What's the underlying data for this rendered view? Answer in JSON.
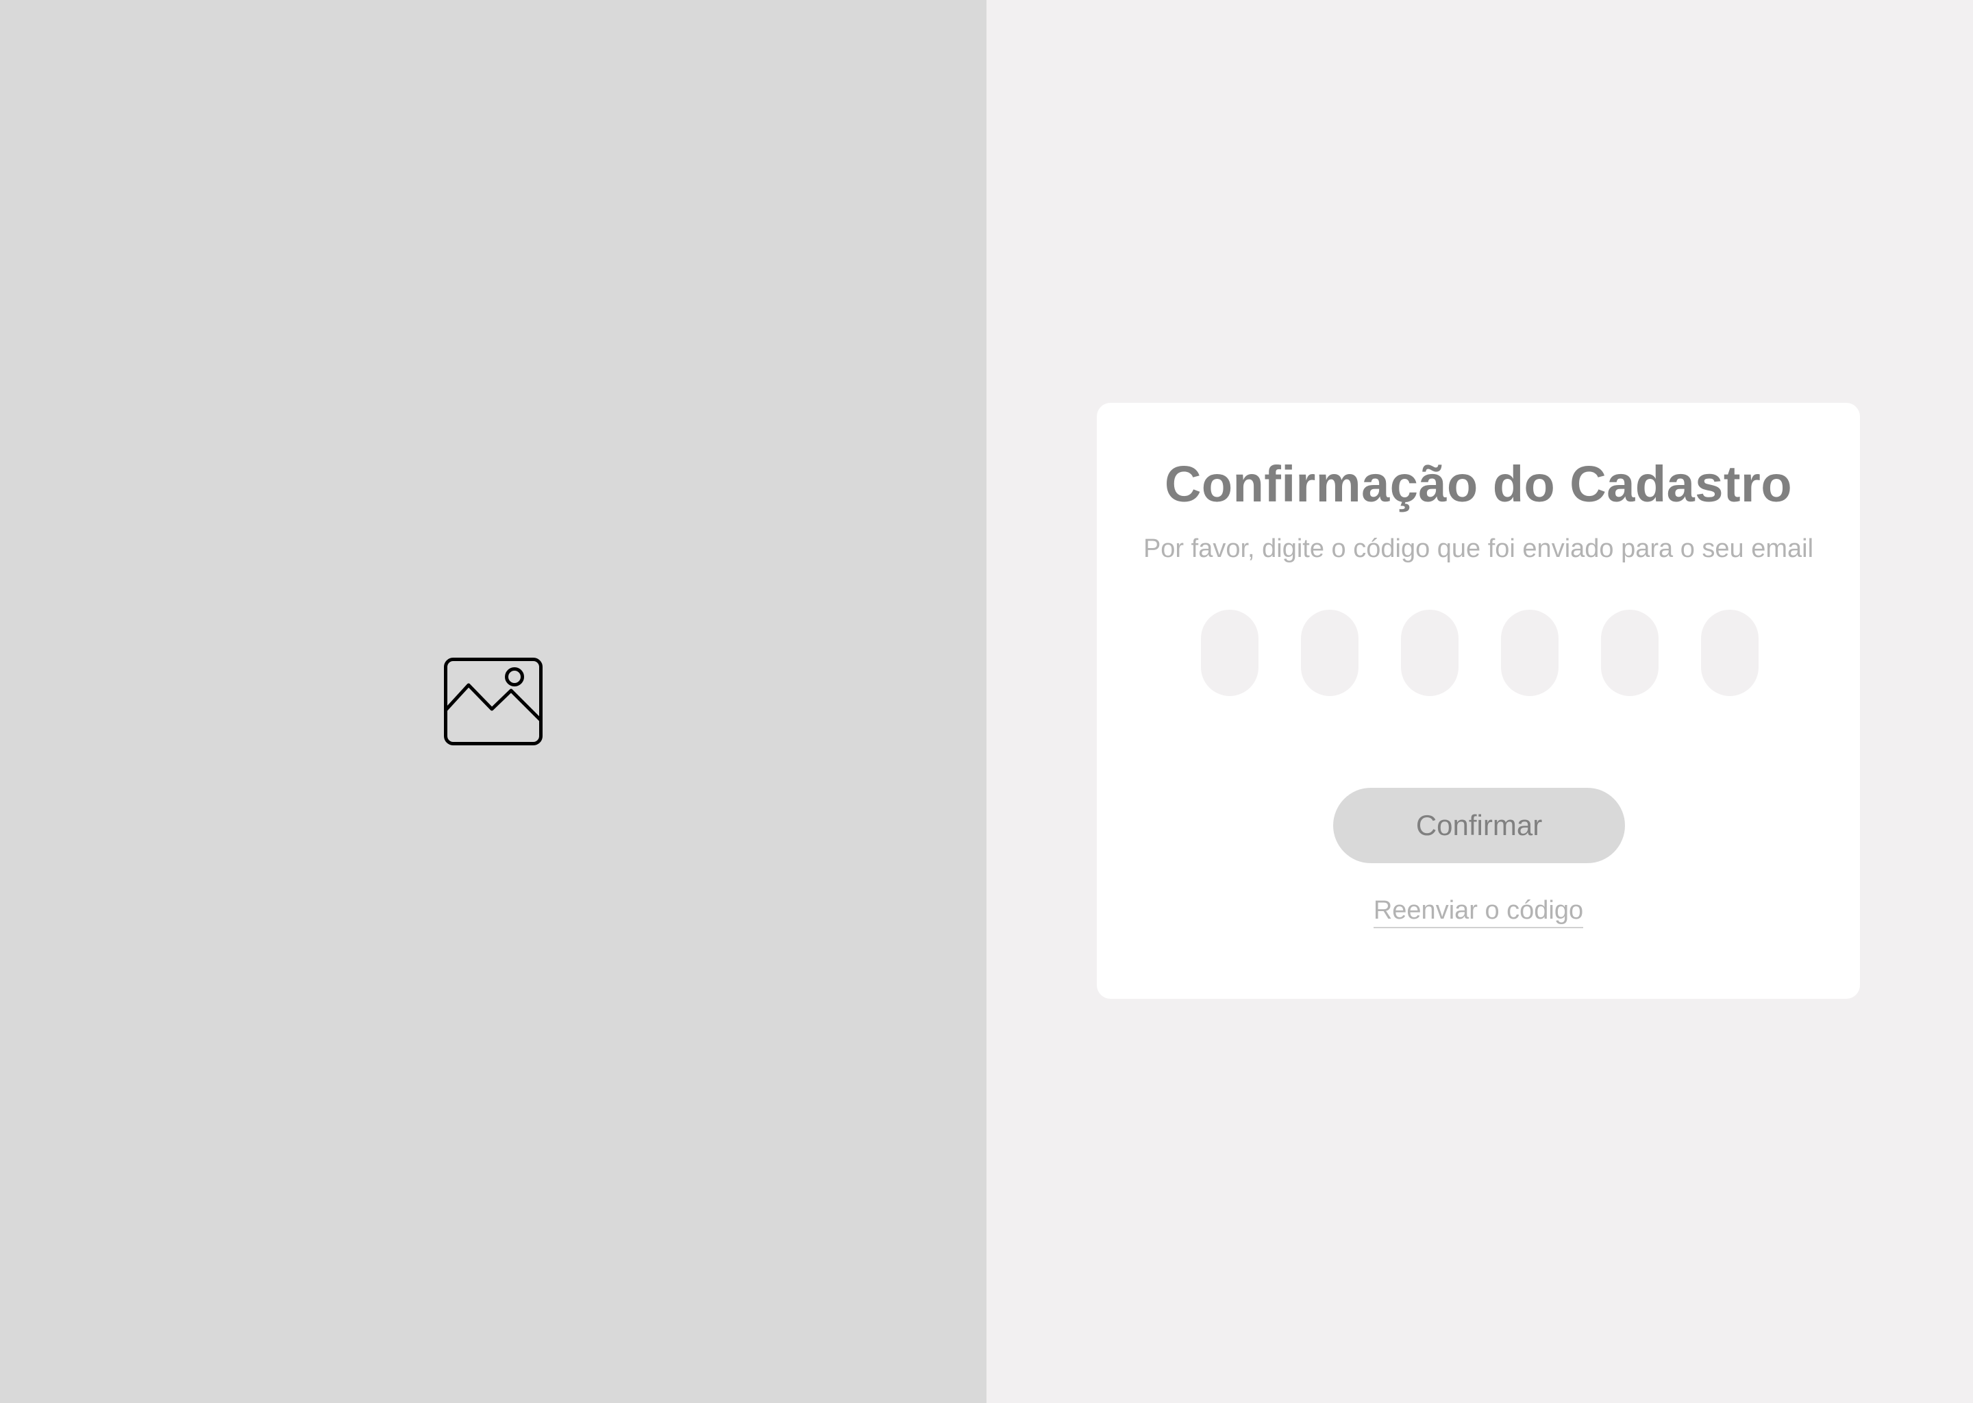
{
  "left_panel": {
    "image_icon": "image-placeholder-icon",
    "background": "#d9d9d9"
  },
  "card": {
    "title": "Confirmação do Cadastro",
    "subtitle": "Por favor, digite o código que foi enviado para o seu email",
    "code_fields": [
      {
        "value": ""
      },
      {
        "value": ""
      },
      {
        "value": ""
      },
      {
        "value": ""
      },
      {
        "value": ""
      },
      {
        "value": ""
      }
    ],
    "confirm_label": "Confirmar",
    "resend_label": "Reenviar o código"
  },
  "colors": {
    "right_background": "#f2f0f1",
    "card_background": "#ffffff",
    "title_text": "#808080",
    "muted_text": "#b3b3b3",
    "field_background": "#f2f0f1",
    "button_background": "#d9d9d9"
  }
}
